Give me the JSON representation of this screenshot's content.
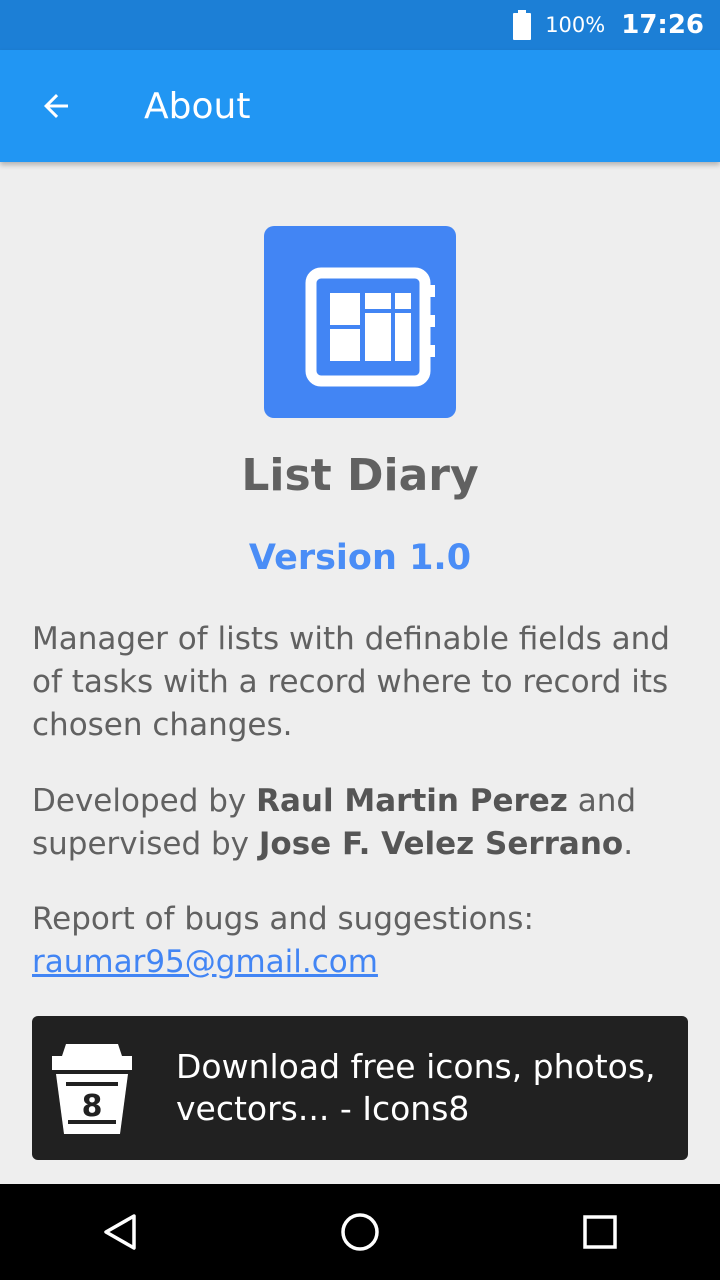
{
  "status_bar": {
    "battery_percent": "100%",
    "time": "17:26"
  },
  "app_bar": {
    "title": "About",
    "back_icon": "arrow-left-icon"
  },
  "about": {
    "app_name": "List Diary",
    "version": "Version 1.0",
    "description": "Manager of lists with definable fields and of tasks with a record where to record its chosen changes.",
    "credits": {
      "developed_prefix": "Developed by ",
      "developer": "Raul Martin Perez",
      "supervised_prefix": " and supervised by ",
      "supervisor": "Jose F. Velez Serrano",
      "suffix": "."
    },
    "report_label": "Report of bugs and suggestions:",
    "email": "raumar95@gmail.com"
  },
  "banner": {
    "text": "Download free icons, photos, vectors... - Icons8",
    "icon_digit": "8"
  },
  "colors": {
    "app_bar": "#2196f3",
    "status_bar": "#1c7fd6",
    "accent": "#4285f4",
    "banner": "#212121"
  }
}
